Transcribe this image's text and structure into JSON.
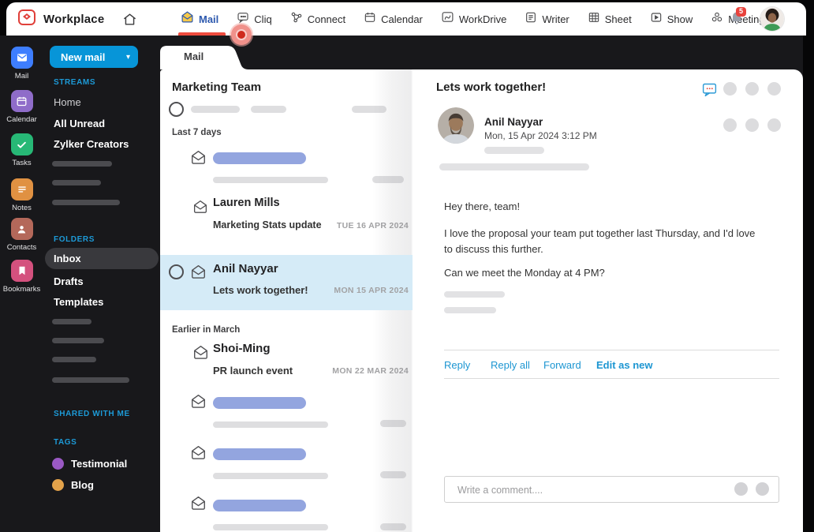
{
  "header": {
    "brand": "Workplace",
    "nav": [
      {
        "label": "Mail"
      },
      {
        "label": "Cliq"
      },
      {
        "label": "Connect"
      },
      {
        "label": "Calendar"
      },
      {
        "label": "WorkDrive"
      },
      {
        "label": "Writer"
      },
      {
        "label": "Sheet"
      },
      {
        "label": "Show"
      },
      {
        "label": "Meeting"
      }
    ],
    "notification_count": "5"
  },
  "app_rail": {
    "items": [
      {
        "label": "Mail",
        "color": "#3e7eff"
      },
      {
        "label": "Calendar",
        "color": "#8f6cc9"
      },
      {
        "label": "Tasks",
        "color": "#27b876"
      },
      {
        "label": "Notes",
        "color": "#e09142"
      },
      {
        "label": "Contacts",
        "color": "#b4685a"
      },
      {
        "label": "Bookmarks",
        "color": "#d4517e"
      }
    ]
  },
  "sidebar": {
    "new_mail_label": "New mail",
    "sections": {
      "streams": {
        "label": "STREAMS",
        "items": [
          "Home",
          "All Unread",
          "Zylker Creators"
        ]
      },
      "folders": {
        "label": "FOLDERS",
        "items": [
          "Inbox",
          "Drafts",
          "Templates"
        ],
        "selected": "Inbox"
      },
      "shared": {
        "label": "SHARED WITH ME"
      },
      "tags": {
        "label": "TAGS",
        "items": [
          {
            "name": "Testimonial",
            "color": "#9a59c4"
          },
          {
            "name": "Blog",
            "color": "#e3a24a"
          }
        ]
      }
    }
  },
  "list": {
    "tab_label": "Mail",
    "title": "Marketing Team",
    "groups": [
      {
        "label": "Last 7 days"
      },
      {
        "label": "Earlier in March"
      }
    ],
    "emails": [
      {
        "sender": "Lauren Mills",
        "subject": "Marketing Stats update",
        "date": "TUE 16 APR 2024"
      },
      {
        "sender": "Anil Nayyar",
        "subject": "Lets work together!",
        "date": "MON 15 APR 2024",
        "selected": true
      },
      {
        "sender": "Shoi-Ming",
        "subject": "PR launch event",
        "date": "MON 22 MAR 2024"
      }
    ]
  },
  "reader": {
    "subject": "Lets work together!",
    "sender": "Anil Nayyar",
    "datetime": "Mon,  15 Apr 2024  3:12 PM",
    "body": [
      "Hey there, team!",
      "I love the proposal your team put together last Thursday, and I'd love to discuss this further.",
      "Can we meet the Monday at 4 PM?"
    ],
    "actions": [
      "Reply",
      "Reply all",
      "Forward",
      "Edit as new"
    ],
    "comment_placeholder": "Write a comment...."
  },
  "colors": {
    "accent_blue": "#0795d8",
    "zoho_red": "#e6453c",
    "link_blue": "#1d96d2",
    "selected_row": "#d5ebf7",
    "skeleton_blue": "#93a5df"
  }
}
